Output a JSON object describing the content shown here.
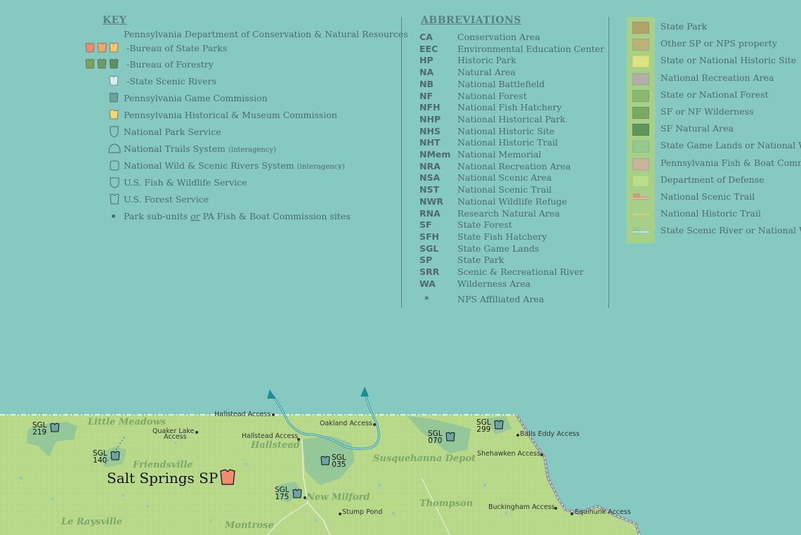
{
  "key": {
    "title": "KEY",
    "dcnr": "Pennsylvania Department of Conservation & Natural Resources",
    "state_parks": "-Bureau of State Parks",
    "forestry": "-Bureau of Forestry",
    "scenic_rivers": "-State Scenic Rivers",
    "game_commission": "Pennsylvania Game Commission",
    "historical": "Pennsylvania Historical & Museum Commission",
    "nps": "National Park Service",
    "trails": "National Trails System",
    "trails_note": "(interagency)",
    "wild_rivers": "National Wild & Scenic Rivers System",
    "wild_rivers_note": "(interagency)",
    "fws": "U.S. Fish & Wildlife Service",
    "usfs": "U.S. Forest Service",
    "subunits_a": "Park sub-units",
    "subunits_or": "or",
    "subunits_b": "PA Fish & Boat Commission sites",
    "colors": {
      "state_parks": [
        "#f08a70",
        "#f5a76a",
        "#f7c66a"
      ],
      "forestry": [
        "#7fa35f",
        "#6f9a63",
        "#5f8f66"
      ]
    }
  },
  "abbreviations": {
    "title": "ABBREVIATIONS",
    "items": [
      {
        "code": "CA",
        "def": "Conservation Area"
      },
      {
        "code": "EEC",
        "def": "Environmental Education Center"
      },
      {
        "code": "HP",
        "def": "Historic Park"
      },
      {
        "code": "NA",
        "def": "Natural Area"
      },
      {
        "code": "NB",
        "def": "National Battlefield"
      },
      {
        "code": "NF",
        "def": "National Forest"
      },
      {
        "code": "NFH",
        "def": "National Fish Hatchery"
      },
      {
        "code": "NHP",
        "def": "National Historical Park"
      },
      {
        "code": "NHS",
        "def": "National Historic Site"
      },
      {
        "code": "NHT",
        "def": "National Historic Trail"
      },
      {
        "code": "NMem",
        "def": "National Memorial"
      },
      {
        "code": "NRA",
        "def": "National Recreation Area"
      },
      {
        "code": "NSA",
        "def": "National Scenic Area"
      },
      {
        "code": "NST",
        "def": "National Scenic Trail"
      },
      {
        "code": "NWR",
        "def": "National Wildlife Refuge"
      },
      {
        "code": "RNA",
        "def": "Research Natural Area"
      },
      {
        "code": "SF",
        "def": "State Forest"
      },
      {
        "code": "SFH",
        "def": "State Fish Hatchery"
      },
      {
        "code": "SGL",
        "def": "State Game Lands"
      },
      {
        "code": "SP",
        "def": "State Park"
      },
      {
        "code": "SRR",
        "def": "Scenic & Recreational River"
      },
      {
        "code": "WA",
        "def": "Wilderness Area"
      },
      {
        "code": "*",
        "def": "NPS Affiliated Area"
      }
    ]
  },
  "legend": {
    "items": [
      {
        "label": "State Park",
        "color": "#b3a36b"
      },
      {
        "label": "Other SP or NPS property",
        "color": "#b8b475"
      },
      {
        "label": "State or National Historic Site",
        "color": "#dfe283"
      },
      {
        "label": "National Recreation Area",
        "color": "#b0b1a6"
      },
      {
        "label": "State or National Forest",
        "color": "#8bb86c"
      },
      {
        "label": "SF or NF Wilderness",
        "color": "#79a963"
      },
      {
        "label": "SF Natural Area",
        "color": "#5f945c"
      },
      {
        "label": "State Game Lands or National Wild",
        "color": "#94ca8f"
      },
      {
        "label": "Pennsylvania Fish & Boat Commis",
        "color": "#c6b49c"
      },
      {
        "label": "Department of Defense",
        "color": "#b9dd89"
      },
      {
        "label": "National Scenic Trail",
        "color": "#e08a7a"
      },
      {
        "label": "National Historic Trail",
        "color": "#d9d45b"
      },
      {
        "label": "State Scenic River or National Wil",
        "color": "#7fc3c4"
      }
    ]
  },
  "map": {
    "places": [
      {
        "id": "hallstead-access",
        "text": "Hallstead Access"
      },
      {
        "id": "oakland-access",
        "text": "Oakland Access"
      },
      {
        "id": "quaker-lake-1",
        "text": "Quaker Lake"
      },
      {
        "id": "quaker-lake-2",
        "text": "Access"
      },
      {
        "id": "hallstead-access-2",
        "text": "Hallstead Access"
      },
      {
        "id": "balls-eddy",
        "text": "Balls Eddy Access"
      },
      {
        "id": "shehawken",
        "text": "Shehawken Access"
      },
      {
        "id": "buckingham",
        "text": "Buckingham Access"
      },
      {
        "id": "equinunk",
        "text": "Equinunk Access"
      },
      {
        "id": "stump-pond",
        "text": "Stump Pond"
      }
    ],
    "towns": {
      "little_meadows": "Little Meadows",
      "hallstead": "Hallstead",
      "friendsville": "Friendsville",
      "susquehanna": "Susquehanna Depot",
      "new_milford": "New Milford",
      "thompson": "Thompson",
      "le_raysville": "Le Raysville",
      "montrose": "Montrose"
    },
    "sgl": {
      "a": {
        "l1": "SGL",
        "l2": "219"
      },
      "b": {
        "l1": "SGL",
        "l2": "140"
      },
      "c": {
        "l1": "SGL",
        "l2": "035"
      },
      "d": {
        "l1": "SGL",
        "l2": "175"
      },
      "e": {
        "l1": "SGL",
        "l2": "070"
      },
      "f": {
        "l1": "SGL",
        "l2": "299"
      }
    },
    "featured_park": "Salt Springs SP"
  }
}
